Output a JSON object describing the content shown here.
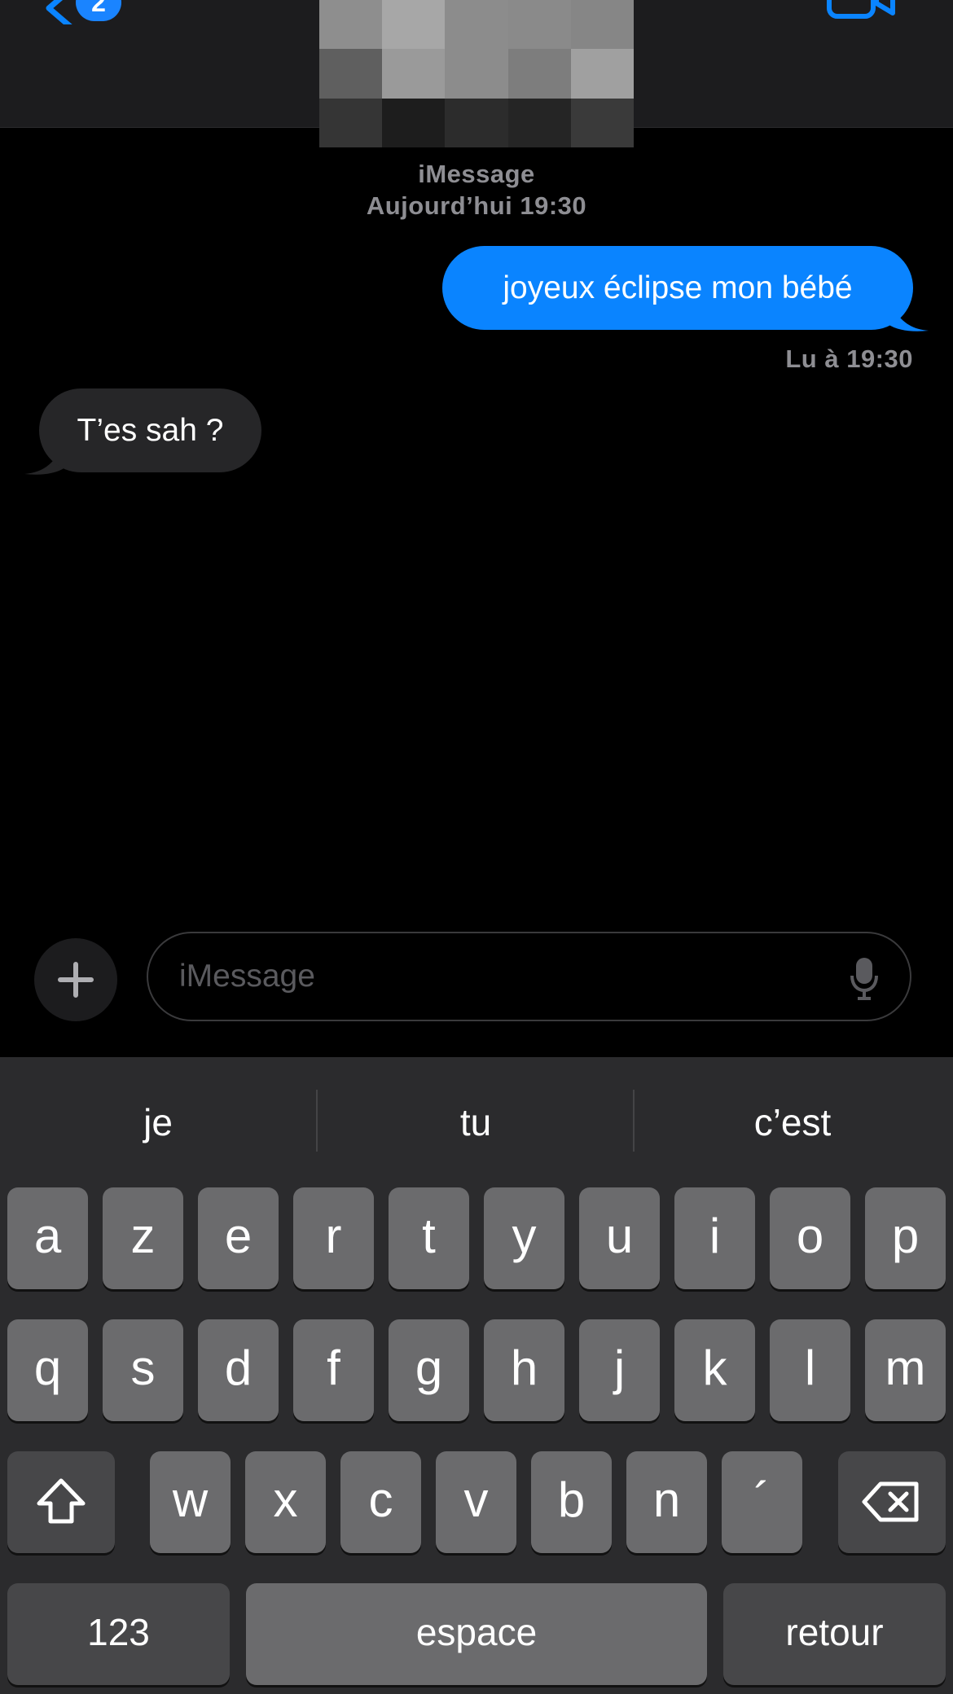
{
  "header": {
    "back_badge": "2"
  },
  "conversation": {
    "service": "iMessage",
    "date": "Aujourd’hui 19:30",
    "messages": [
      {
        "direction": "outgoing",
        "text": "joyeux éclipse mon bébé"
      },
      {
        "direction": "incoming",
        "text": "T’es sah ?"
      }
    ],
    "read_receipt": {
      "label": "Lu",
      "rest": " à 19:30"
    }
  },
  "input": {
    "placeholder": "iMessage"
  },
  "keyboard": {
    "predictions": [
      "je",
      "tu",
      "c’est"
    ],
    "row1": [
      "a",
      "z",
      "e",
      "r",
      "t",
      "y",
      "u",
      "i",
      "o",
      "p"
    ],
    "row2": [
      "q",
      "s",
      "d",
      "f",
      "g",
      "h",
      "j",
      "k",
      "l",
      "m"
    ],
    "row3": [
      "w",
      "x",
      "c",
      "v",
      "b",
      "n",
      "´"
    ],
    "numbers": "123",
    "space": "espace",
    "return": "retour"
  },
  "colors": {
    "accent": "#0a84ff",
    "incoming_bubble": "#262628",
    "keyboard_bg": "#2b2b2d",
    "key": "#6b6b6d",
    "key_dark": "#474749"
  },
  "icons": [
    "back-chevron-icon",
    "video-camera-icon",
    "plus-icon",
    "microphone-icon",
    "shift-icon",
    "delete-icon"
  ]
}
